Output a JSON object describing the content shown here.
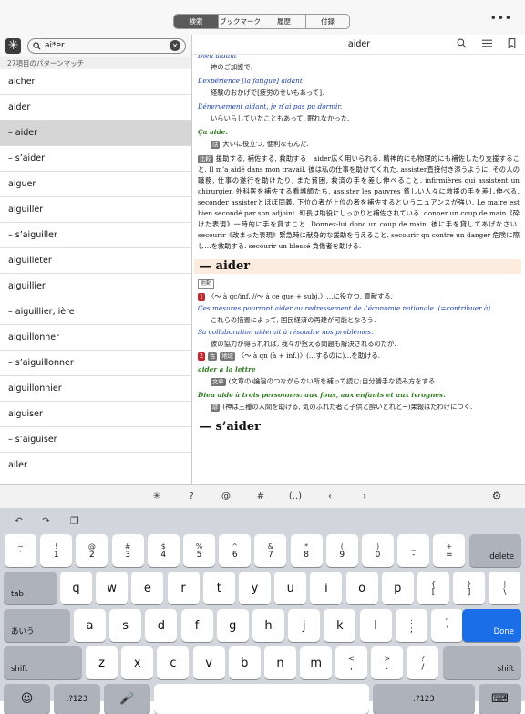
{
  "tabs": [
    "検索",
    "ブックマーク",
    "履歴",
    "付録"
  ],
  "more": "•••",
  "search": {
    "value": "ai*er",
    "clear": "✕",
    "asterisk": "✳"
  },
  "match_count": "27項目のパターンマッチ",
  "results": [
    "aicher",
    "aider",
    "– aider",
    "– s’aider",
    "aiguer",
    "aiguiller",
    "– s’aiguiller",
    "aiguilleter",
    "aiguillier",
    "– aiguillier, ière",
    "aiguillonner",
    "– s’aiguillonner",
    "aiguillonnier",
    "aiguiser",
    "– s’aiguiser",
    "ailer"
  ],
  "selected_index": 2,
  "entry_title": "aider",
  "entry": {
    "l0": "Dieu aidant",
    "l1": "神のご加護で.",
    "l2": "L’expérience [la fatigue] aidant",
    "l3": "経験のおかげで[疲労のせいもあって].",
    "l4": "L’énervement aidant, je n’ai pas pu dormir.",
    "l5": "いらいらしていたこともあって, 眠れなかった.",
    "l6": "Ça aide.",
    "l7tag": "話",
    "l7": "大いに役立つ, 便利なもんだ.",
    "para_tag": "比較",
    "para": "援助する, 補佐する, 救助する　aider広く用いられる. 精神的にも物理的にも補佐したり支援すること. Il m’a aidé dans mon travail. 彼は私の仕事を助けてくれた. assister直接付き添うように, その人の職務, 仕事の遂行を助けたり, また貧困, 救済の手を差し伸べること. infirmières qui assistent un chirurgien 外科医を補佐する看護師たち, assister les pauvres 貧しい人々に救援の手を差し伸べる. seconder assisterとほぼ同義. 下位の者が上位の者を補佐するというニュアンスが強い. Le maire est bien secondé par son adjoint. 町長は助役にしっかりと補佐されている. donner un coup de main《砕けた表現》一時的に手を貸すこと. Donnez-lui donc un coup de main. 彼に手を貸してあげなさい. secourir《改まった表現》緊急時に献身的な援助を与えること. secourir qn contre un danger 危険に際し…を救助する. secourir un blessé 負傷者を助ける.",
    "h1": "― aider",
    "verb_tag": "他動",
    "n1": "1",
    "d1": "〈～ à qc/inf. //～ à ce que + subj.〉…に役立つ, 貢献する.",
    "e1": "Ces mesures pourront aider au redressement de l’économie nationale. (=contribuer à)",
    "e1j": "これらの措置によって, 国民経済の再建が可能となろう.",
    "e2": "Sa collaboration aiderait à résoudre nos problèmes.",
    "e2j": "彼の協力が得られれば, 我々が抱える問題も解決されるのだが.",
    "n2": "2",
    "d2tags": [
      "古",
      "地域"
    ],
    "d2": "〈～ à qn (à + inf.)〉(…するのに)…を助ける.",
    "g1": "aider à la lettre",
    "g1tag": "文章",
    "g1j": "(文章の)論旨のつながらない所を補って読む;自分勝手な読み方をする.",
    "g2": "Dieu aide à trois personnes: aux fous, aux enfants et aux ivrognes.",
    "g2tag": "諺",
    "g2j": "(神は三種の人間を助ける, 気のふれた者と子供と酔いどれと→)果報はたわけにつく.",
    "h2": "― s’aider"
  },
  "toolbar": [
    "✳",
    "?",
    "@",
    "#",
    "(..)",
    "‹",
    "›"
  ],
  "keyboard": {
    "row1": [
      [
        "~",
        "`"
      ],
      [
        "!",
        "1"
      ],
      [
        "@",
        "2"
      ],
      [
        "#",
        "3"
      ],
      [
        "$",
        "4"
      ],
      [
        "%",
        "5"
      ],
      [
        "^",
        "6"
      ],
      [
        "&",
        "7"
      ],
      [
        "*",
        "8"
      ],
      [
        "(",
        "9"
      ],
      [
        ")",
        "0"
      ],
      [
        "_",
        "-"
      ],
      [
        "+",
        "="
      ]
    ],
    "delete": "delete",
    "tab": "tab",
    "row2": [
      "q",
      "w",
      "e",
      "r",
      "t",
      "y",
      "u",
      "i",
      "o",
      "p"
    ],
    "row2p": [
      [
        "{",
        "["
      ],
      [
        "}",
        "]"
      ],
      [
        "|",
        "\\"
      ]
    ],
    "kana": "あいう",
    "row3": [
      "a",
      "s",
      "d",
      "f",
      "g",
      "h",
      "j",
      "k",
      "l"
    ],
    "row3p": [
      [
        ":",
        ";"
      ],
      [
        "”",
        "’"
      ]
    ],
    "done": "Done",
    "shift": "shift",
    "row4": [
      "z",
      "x",
      "c",
      "v",
      "b",
      "n",
      "m"
    ],
    "row4p": [
      [
        "<",
        ","
      ],
      [
        ">",
        "."
      ],
      [
        "?",
        "/"
      ]
    ],
    "num": ".?123",
    "emoji": "☺",
    "mic": "🎤",
    "hide": "⌨"
  }
}
